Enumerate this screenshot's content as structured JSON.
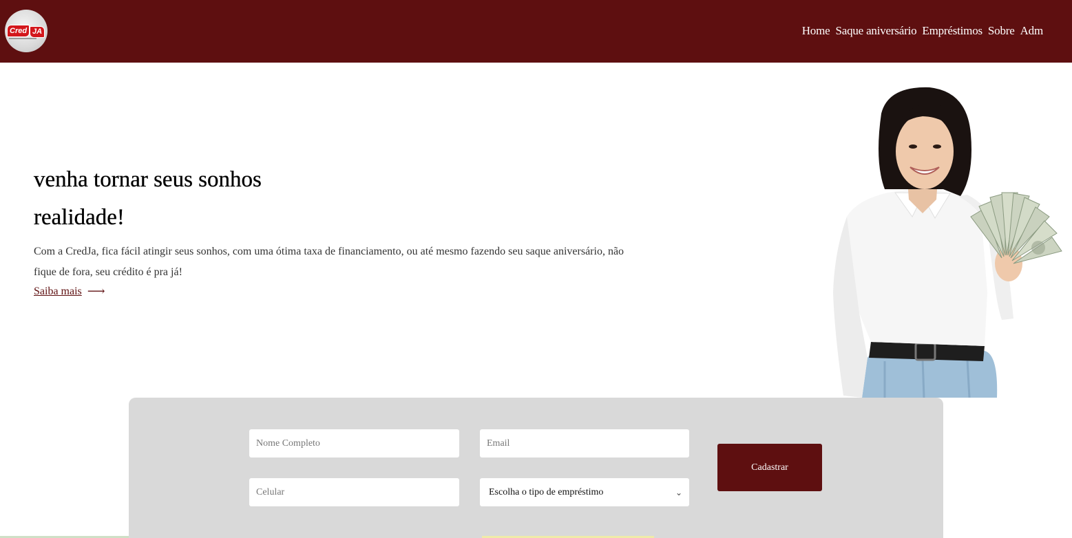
{
  "header": {
    "logo_text_left": "Cred",
    "logo_text_right": "JA",
    "nav": [
      "Home",
      "Saque aniversário",
      "Empréstimos",
      "Sobre",
      "Adm"
    ]
  },
  "hero": {
    "title_line1": "venha tornar seus sonhos",
    "title_line2": "realidade!",
    "text": "Com a CredJa, fica fácil atingir seus sonhos, com uma ótima taxa de financiamento, ou até mesmo fazendo seu saque aniversário, não fique de fora, seu crédito é pra já!",
    "saiba_mais": "Saiba mais",
    "arrow": "⟶"
  },
  "form": {
    "nome_placeholder": "Nome Completo",
    "email_placeholder": "Email",
    "celular_placeholder": "Celular",
    "select_value": "Escolha o tipo de empréstimo",
    "submit_label": "Cadastrar"
  },
  "colors": {
    "brand": "#5e0f10",
    "panel": "#d9d9d9",
    "logo_red": "#d3171c"
  },
  "icons": {
    "select_chevron": "chevron-down-icon",
    "link_arrow": "arrow-right-icon"
  }
}
